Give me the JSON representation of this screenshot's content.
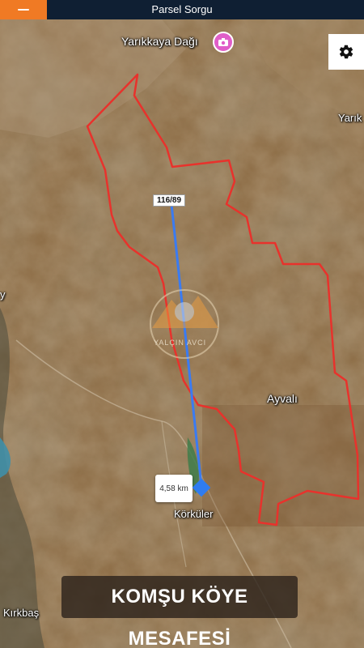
{
  "app": {
    "title": "Parsel Sorgu",
    "menu_icon": "hamburger-icon",
    "settings_icon": "gear-icon",
    "accent_color": "#f07a24",
    "header_color": "#0f1f33"
  },
  "map": {
    "places": {
      "yarikkaya_dagi": "Yarıkkaya Dağı",
      "yarik": "Yarık",
      "ayvali": "Ayvalı",
      "korkuler": "Körküler",
      "kirkbas": "Kırkbaş",
      "left_edge": "y"
    },
    "parcel_label": "116/89",
    "distance_label": "4,58 km",
    "boundary_color": "#e8322c",
    "measure_line_color": "#3a7bf2",
    "watermark_text": "YALÇIN AVCI"
  },
  "caption": "KOMŞU KÖYE MESAFESİ"
}
